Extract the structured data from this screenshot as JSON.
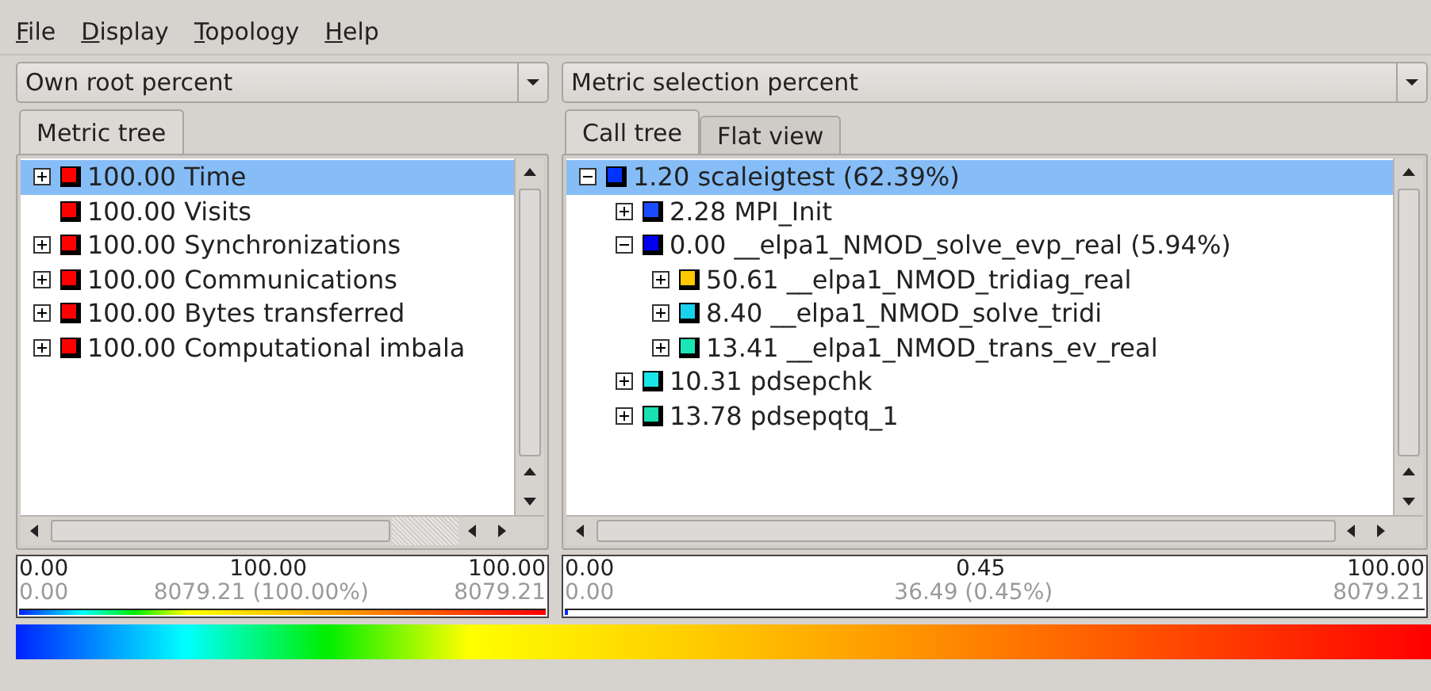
{
  "menu": [
    {
      "label": "File"
    },
    {
      "label": "Display"
    },
    {
      "label": "Topology"
    },
    {
      "label": "Help"
    }
  ],
  "panels": [
    {
      "dropdown": "Own root percent",
      "tabs": [
        {
          "label": "Metric tree",
          "selected": true
        }
      ],
      "tree": [
        {
          "label": "100.00 Time",
          "color": "#ff0000",
          "expandable": true,
          "expanded": false,
          "selected": true
        },
        {
          "label": "100.00 Visits",
          "color": "#ff0000",
          "expandable": false,
          "selected": false
        },
        {
          "label": "100.00 Synchronizations",
          "color": "#ff0000",
          "expandable": true,
          "expanded": false,
          "selected": false
        },
        {
          "label": "100.00 Communications",
          "color": "#ff0000",
          "expandable": true,
          "expanded": false,
          "selected": false
        },
        {
          "label": "100.00 Bytes transferred",
          "color": "#ff0000",
          "expandable": true,
          "expanded": false,
          "selected": false
        },
        {
          "label": "100.00 Computational imbala",
          "color": "#ff0000",
          "expandable": true,
          "expanded": false,
          "selected": false
        }
      ],
      "value_bar": {
        "min": "0.00",
        "center": "100.00",
        "max": "100.00",
        "min_abs": "0.00",
        "center_abs": "8079.21 (100.00%)",
        "max_abs": "8079.21",
        "level": 1
      }
    },
    {
      "dropdown": "Metric selection percent",
      "tabs": [
        {
          "label": "Call tree",
          "selected": true
        },
        {
          "label": "Flat view",
          "selected": false
        }
      ],
      "tree": [
        {
          "label": "1.20 scaleigtest (62.39%)",
          "color": "#0033ff",
          "expandable": true,
          "expanded": true,
          "selected": true,
          "children": [
            {
              "label": "2.28 MPI_Init",
              "color": "#1a4cff",
              "expandable": true,
              "expanded": false,
              "selected": false
            },
            {
              "label": "0.00 __elpa1_NMOD_solve_evp_real (5.94%)",
              "color": "#0000ee",
              "expandable": true,
              "expanded": true,
              "selected": false,
              "children": [
                {
                  "label": "50.61 __elpa1_NMOD_tridiag_real",
                  "color": "#ffc800",
                  "expandable": true,
                  "expanded": false,
                  "selected": false
                },
                {
                  "label": "8.40 __elpa1_NMOD_solve_tridi",
                  "color": "#19d2ee",
                  "expandable": true,
                  "expanded": false,
                  "selected": false
                },
                {
                  "label": "13.41 __elpa1_NMOD_trans_ev_real",
                  "color": "#19e6b4",
                  "expandable": true,
                  "expanded": false,
                  "selected": false
                }
              ]
            },
            {
              "label": "10.31 pdsepchk",
              "color": "#19e6e6",
              "expandable": true,
              "expanded": false,
              "selected": false
            },
            {
              "label": "13.78 pdsepqtq_1",
              "color": "#19e0b0",
              "expandable": true,
              "expanded": false,
              "selected": false
            }
          ]
        }
      ],
      "value_bar": {
        "min": "0.00",
        "center": "0.45",
        "max": "100.00",
        "min_abs": "0.00",
        "center_abs": "36.49 (0.45%)",
        "max_abs": "8079.21",
        "level": 0.0045
      }
    }
  ]
}
